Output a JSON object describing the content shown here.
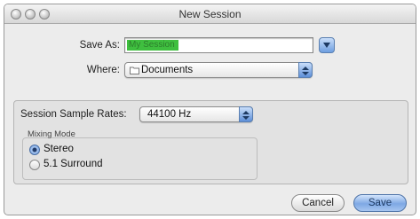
{
  "window": {
    "title": "New Session"
  },
  "save_as": {
    "label": "Save As:",
    "value": "My Session"
  },
  "where": {
    "label": "Where:",
    "value": "Documents",
    "icon": "folder-icon"
  },
  "sample_rates": {
    "label": "Session Sample Rates:",
    "value": "44100 Hz"
  },
  "mixing_mode": {
    "title": "Mixing Mode",
    "options": [
      {
        "label": "Stereo",
        "selected": true
      },
      {
        "label": "5.1 Surround",
        "selected": false
      }
    ]
  },
  "buttons": {
    "cancel": "Cancel",
    "save": "Save"
  },
  "colors": {
    "accent": "#6e9ee0",
    "selection": "#3fbf3f"
  }
}
